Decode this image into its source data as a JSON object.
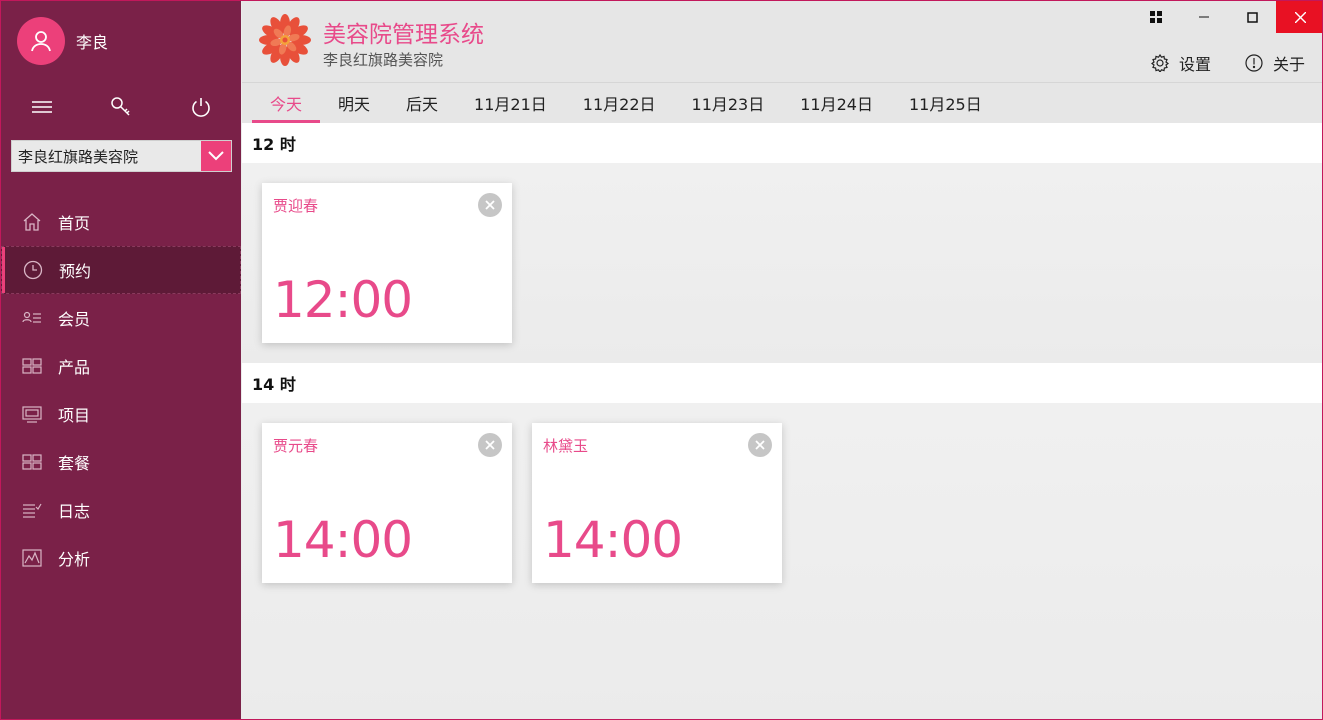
{
  "user": {
    "name": "李良"
  },
  "store_select": {
    "value": "李良红旗路美容院"
  },
  "nav": [
    {
      "label": "首页",
      "icon": "home-icon"
    },
    {
      "label": "预约",
      "icon": "clock-icon",
      "active": true
    },
    {
      "label": "会员",
      "icon": "member-list-icon"
    },
    {
      "label": "产品",
      "icon": "product-grid-icon"
    },
    {
      "label": "项目",
      "icon": "project-monitor-icon"
    },
    {
      "label": "套餐",
      "icon": "package-grid-icon"
    },
    {
      "label": "日志",
      "icon": "log-list-icon"
    },
    {
      "label": "分析",
      "icon": "analysis-chart-icon"
    }
  ],
  "header": {
    "title": "美容院管理系统",
    "subtitle": "李良红旗路美容院",
    "settings_label": "设置",
    "about_label": "关于"
  },
  "tabs": [
    "今天",
    "明天",
    "后天",
    "11月21日",
    "11月22日",
    "11月23日",
    "11月24日",
    "11月25日"
  ],
  "groups": [
    {
      "hour": "12 时",
      "appointments": [
        {
          "name": "贾迎春",
          "time": "12:00"
        }
      ]
    },
    {
      "hour": "14 时",
      "appointments": [
        {
          "name": "贾元春",
          "time": "14:00"
        },
        {
          "name": "林黛玉",
          "time": "14:00"
        }
      ]
    }
  ],
  "colors": {
    "sidebar": "#7a2148",
    "accent": "#e84a8a",
    "close": "#e81123"
  }
}
